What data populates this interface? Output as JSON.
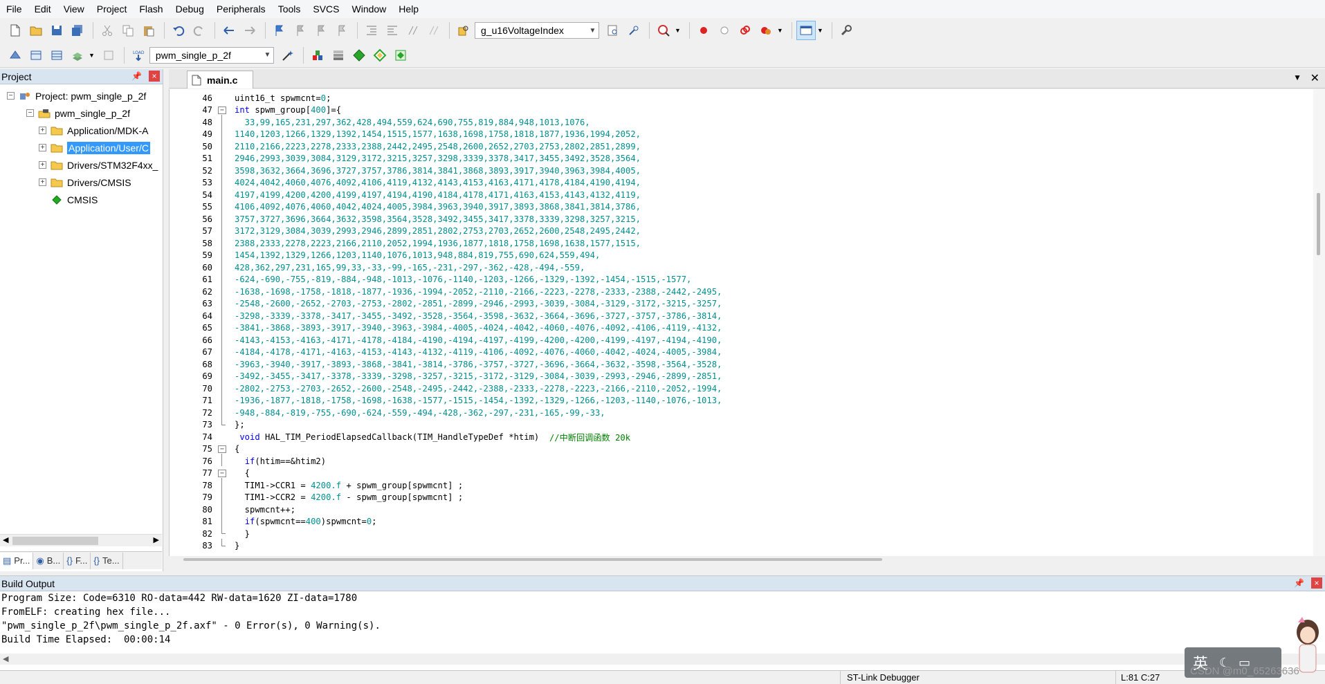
{
  "menu": [
    "File",
    "Edit",
    "View",
    "Project",
    "Flash",
    "Debug",
    "Peripherals",
    "Tools",
    "SVCS",
    "Window",
    "Help"
  ],
  "toolbar1": {
    "find_combo_value": "g_u16VoltageIndex"
  },
  "toolbar2": {
    "target_combo_value": "pwm_single_p_2f"
  },
  "project_panel": {
    "title": "Project",
    "pin": "📌",
    "close": "×",
    "tree": [
      {
        "label": "Project: pwm_single_p_2f",
        "expander": "−",
        "icon": "project-root-icon"
      },
      {
        "label": "pwm_single_p_2f",
        "expander": "−",
        "icon": "target-icon"
      },
      {
        "label": "Application/MDK-A",
        "expander": "+",
        "icon": "folder-icon"
      },
      {
        "label": "Application/User/C",
        "expander": "+",
        "icon": "folder-icon",
        "selected": true
      },
      {
        "label": "Drivers/STM32F4xx_",
        "expander": "+",
        "icon": "folder-icon"
      },
      {
        "label": "Drivers/CMSIS",
        "expander": "+",
        "icon": "folder-icon"
      },
      {
        "label": "CMSIS",
        "expander": "",
        "icon": "cmsis-diamond-icon"
      }
    ],
    "tabs": [
      {
        "label": "Pr...",
        "icon": "project-tab-icon"
      },
      {
        "label": "B...",
        "icon": "books-tab-icon"
      },
      {
        "label": "F...",
        "icon": "functions-tab-icon"
      },
      {
        "label": "Te...",
        "icon": "templates-tab-icon"
      }
    ]
  },
  "editor": {
    "tab_label": "main.c",
    "tab_menu": "▼",
    "tab_close": "✕",
    "lines": [
      {
        "n": "46",
        "fold": "none",
        "tokens": [
          {
            "t": "uint16_t spwmcnt=",
            "c": ""
          },
          {
            "t": "0",
            "c": "num"
          },
          {
            "t": ";",
            "c": ""
          }
        ]
      },
      {
        "n": "47",
        "fold": "box",
        "tokens": [
          {
            "t": "int",
            "c": "kw"
          },
          {
            "t": " spwm_group[",
            "c": ""
          },
          {
            "t": "400",
            "c": "num"
          },
          {
            "t": "]={",
            "c": ""
          }
        ]
      },
      {
        "n": "48",
        "fold": "bar",
        "tokens": [
          {
            "t": "  33,99,165,231,297,362,428,494,559,624,690,755,819,884,948,1013,1076,",
            "c": "num"
          }
        ]
      },
      {
        "n": "49",
        "fold": "bar",
        "tokens": [
          {
            "t": "1140,1203,1266,1329,1392,1454,1515,1577,1638,1698,1758,1818,1877,1936,1994,2052,",
            "c": "num"
          }
        ]
      },
      {
        "n": "50",
        "fold": "bar",
        "tokens": [
          {
            "t": "2110,2166,2223,2278,2333,2388,2442,2495,2548,2600,2652,2703,2753,2802,2851,2899,",
            "c": "num"
          }
        ]
      },
      {
        "n": "51",
        "fold": "bar",
        "tokens": [
          {
            "t": "2946,2993,3039,3084,3129,3172,3215,3257,3298,3339,3378,3417,3455,3492,3528,3564,",
            "c": "num"
          }
        ]
      },
      {
        "n": "52",
        "fold": "bar",
        "tokens": [
          {
            "t": "3598,3632,3664,3696,3727,3757,3786,3814,3841,3868,3893,3917,3940,3963,3984,4005,",
            "c": "num"
          }
        ]
      },
      {
        "n": "53",
        "fold": "bar",
        "tokens": [
          {
            "t": "4024,4042,4060,4076,4092,4106,4119,4132,4143,4153,4163,4171,4178,4184,4190,4194,",
            "c": "num"
          }
        ]
      },
      {
        "n": "54",
        "fold": "bar",
        "tokens": [
          {
            "t": "4197,4199,4200,4200,4199,4197,4194,4190,4184,4178,4171,4163,4153,4143,4132,4119,",
            "c": "num"
          }
        ]
      },
      {
        "n": "55",
        "fold": "bar",
        "tokens": [
          {
            "t": "4106,4092,4076,4060,4042,4024,4005,3984,3963,3940,3917,3893,3868,3841,3814,3786,",
            "c": "num"
          }
        ]
      },
      {
        "n": "56",
        "fold": "bar",
        "tokens": [
          {
            "t": "3757,3727,3696,3664,3632,3598,3564,3528,3492,3455,3417,3378,3339,3298,3257,3215,",
            "c": "num"
          }
        ]
      },
      {
        "n": "57",
        "fold": "bar",
        "tokens": [
          {
            "t": "3172,3129,3084,3039,2993,2946,2899,2851,2802,2753,2703,2652,2600,2548,2495,2442,",
            "c": "num"
          }
        ]
      },
      {
        "n": "58",
        "fold": "bar",
        "tokens": [
          {
            "t": "2388,2333,2278,2223,2166,2110,2052,1994,1936,1877,1818,1758,1698,1638,1577,1515,",
            "c": "num"
          }
        ]
      },
      {
        "n": "59",
        "fold": "bar",
        "tokens": [
          {
            "t": "1454,1392,1329,1266,1203,1140,1076,1013,948,884,819,755,690,624,559,494,",
            "c": "num"
          }
        ]
      },
      {
        "n": "60",
        "fold": "bar",
        "tokens": [
          {
            "t": "428,362,297,231,165,99,33,-33,-99,-165,-231,-297,-362,-428,-494,-559,",
            "c": "num"
          }
        ]
      },
      {
        "n": "61",
        "fold": "bar",
        "tokens": [
          {
            "t": "-624,-690,-755,-819,-884,-948,-1013,-1076,-1140,-1203,-1266,-1329,-1392,-1454,-1515,-1577,",
            "c": "num"
          }
        ]
      },
      {
        "n": "62",
        "fold": "bar",
        "tokens": [
          {
            "t": "-1638,-1698,-1758,-1818,-1877,-1936,-1994,-2052,-2110,-2166,-2223,-2278,-2333,-2388,-2442,-2495,",
            "c": "num"
          }
        ]
      },
      {
        "n": "63",
        "fold": "bar",
        "tokens": [
          {
            "t": "-2548,-2600,-2652,-2703,-2753,-2802,-2851,-2899,-2946,-2993,-3039,-3084,-3129,-3172,-3215,-3257,",
            "c": "num"
          }
        ]
      },
      {
        "n": "64",
        "fold": "bar",
        "tokens": [
          {
            "t": "-3298,-3339,-3378,-3417,-3455,-3492,-3528,-3564,-3598,-3632,-3664,-3696,-3727,-3757,-3786,-3814,",
            "c": "num"
          }
        ]
      },
      {
        "n": "65",
        "fold": "bar",
        "tokens": [
          {
            "t": "-3841,-3868,-3893,-3917,-3940,-3963,-3984,-4005,-4024,-4042,-4060,-4076,-4092,-4106,-4119,-4132,",
            "c": "num"
          }
        ]
      },
      {
        "n": "66",
        "fold": "bar",
        "tokens": [
          {
            "t": "-4143,-4153,-4163,-4171,-4178,-4184,-4190,-4194,-4197,-4199,-4200,-4200,-4199,-4197,-4194,-4190,",
            "c": "num"
          }
        ]
      },
      {
        "n": "67",
        "fold": "bar",
        "tokens": [
          {
            "t": "-4184,-4178,-4171,-4163,-4153,-4143,-4132,-4119,-4106,-4092,-4076,-4060,-4042,-4024,-4005,-3984,",
            "c": "num"
          }
        ]
      },
      {
        "n": "68",
        "fold": "bar",
        "tokens": [
          {
            "t": "-3963,-3940,-3917,-3893,-3868,-3841,-3814,-3786,-3757,-3727,-3696,-3664,-3632,-3598,-3564,-3528,",
            "c": "num"
          }
        ]
      },
      {
        "n": "69",
        "fold": "bar",
        "tokens": [
          {
            "t": "-3492,-3455,-3417,-3378,-3339,-3298,-3257,-3215,-3172,-3129,-3084,-3039,-2993,-2946,-2899,-2851,",
            "c": "num"
          }
        ]
      },
      {
        "n": "70",
        "fold": "bar",
        "tokens": [
          {
            "t": "-2802,-2753,-2703,-2652,-2600,-2548,-2495,-2442,-2388,-2333,-2278,-2223,-2166,-2110,-2052,-1994,",
            "c": "num"
          }
        ]
      },
      {
        "n": "71",
        "fold": "bar",
        "tokens": [
          {
            "t": "-1936,-1877,-1818,-1758,-1698,-1638,-1577,-1515,-1454,-1392,-1329,-1266,-1203,-1140,-1076,-1013,",
            "c": "num"
          }
        ]
      },
      {
        "n": "72",
        "fold": "bar",
        "tokens": [
          {
            "t": "-948,-884,-819,-755,-690,-624,-559,-494,-428,-362,-297,-231,-165,-99,-33,",
            "c": "num"
          }
        ]
      },
      {
        "n": "73",
        "fold": "end",
        "tokens": [
          {
            "t": "};",
            "c": ""
          }
        ]
      },
      {
        "n": "74",
        "fold": "none",
        "tokens": [
          {
            "t": " void",
            "c": "kw"
          },
          {
            "t": " HAL_TIM_PeriodElapsedCallback(TIM_HandleTypeDef *htim)  ",
            "c": ""
          },
          {
            "t": "//中断回调函数 20k",
            "c": "cmt"
          }
        ]
      },
      {
        "n": "75",
        "fold": "box",
        "tokens": [
          {
            "t": "{",
            "c": ""
          }
        ]
      },
      {
        "n": "76",
        "fold": "bar",
        "tokens": [
          {
            "t": "  ",
            "c": ""
          },
          {
            "t": "if",
            "c": "kw"
          },
          {
            "t": "(htim==&htim2)",
            "c": ""
          }
        ]
      },
      {
        "n": "77",
        "fold": "box",
        "tokens": [
          {
            "t": "  {",
            "c": ""
          }
        ]
      },
      {
        "n": "78",
        "fold": "bar",
        "tokens": [
          {
            "t": "  TIM1->CCR1 = ",
            "c": ""
          },
          {
            "t": "4200.f",
            "c": "num"
          },
          {
            "t": " + spwm_group[spwmcnt] ;",
            "c": ""
          }
        ]
      },
      {
        "n": "79",
        "fold": "bar",
        "tokens": [
          {
            "t": "  TIM1->CCR2 = ",
            "c": ""
          },
          {
            "t": "4200.f",
            "c": "num"
          },
          {
            "t": " - spwm_group[spwmcnt] ;",
            "c": ""
          }
        ]
      },
      {
        "n": "80",
        "fold": "bar",
        "tokens": [
          {
            "t": "  spwmcnt++;",
            "c": ""
          }
        ]
      },
      {
        "n": "81",
        "fold": "bar",
        "tokens": [
          {
            "t": "  ",
            "c": ""
          },
          {
            "t": "if",
            "c": "kw"
          },
          {
            "t": "(spwmcnt==",
            "c": ""
          },
          {
            "t": "400",
            "c": "num"
          },
          {
            "t": ")spwmcnt=",
            "c": ""
          },
          {
            "t": "0",
            "c": "num"
          },
          {
            "t": ";",
            "c": ""
          }
        ]
      },
      {
        "n": "82",
        "fold": "end",
        "tokens": [
          {
            "t": "  }",
            "c": ""
          }
        ]
      },
      {
        "n": "83",
        "fold": "end",
        "tokens": [
          {
            "t": "}",
            "c": ""
          }
        ]
      }
    ]
  },
  "build_output": {
    "title": "Build Output",
    "pin": "📌",
    "close": "×",
    "lines": [
      "Program Size: Code=6310 RO-data=442 RW-data=1620 ZI-data=1780",
      "FromELF: creating hex file...",
      "\"pwm_single_p_2f\\pwm_single_p_2f.axf\" - 0 Error(s), 0 Warning(s).",
      "Build Time Elapsed:  00:00:14"
    ]
  },
  "statusbar": {
    "debugger": "ST-Link Debugger",
    "position": "L:81 C:27"
  },
  "overlay": {
    "ime_char": "英",
    "watermark": "CSDN @m0_65263636"
  },
  "colors": {
    "number": "#009090",
    "keyword": "#0000ff",
    "comment": "#008000",
    "selection": "#3399ff",
    "panel_title": "#d9e4f1"
  }
}
